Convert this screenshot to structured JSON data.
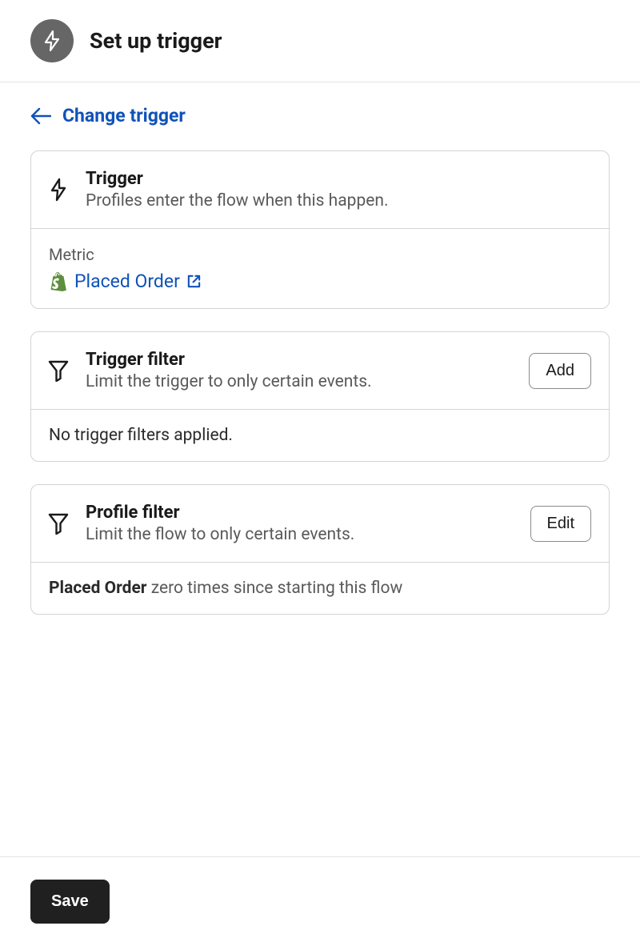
{
  "header": {
    "title": "Set up trigger"
  },
  "changeTrigger": {
    "label": "Change trigger"
  },
  "triggerCard": {
    "title": "Trigger",
    "subtitle": "Profiles enter the flow when this happen.",
    "metricLabel": "Metric",
    "metricValue": "Placed Order"
  },
  "triggerFilterCard": {
    "title": "Trigger filter",
    "subtitle": "Limit the trigger to only certain events.",
    "buttonLabel": "Add",
    "bodyText": "No trigger filters applied."
  },
  "profileFilterCard": {
    "title": "Profile filter",
    "subtitle": "Limit the flow to only certain events.",
    "buttonLabel": "Edit",
    "bodyBold": "Placed Order",
    "bodyRest": " zero times since starting this flow"
  },
  "footer": {
    "saveLabel": "Save"
  }
}
